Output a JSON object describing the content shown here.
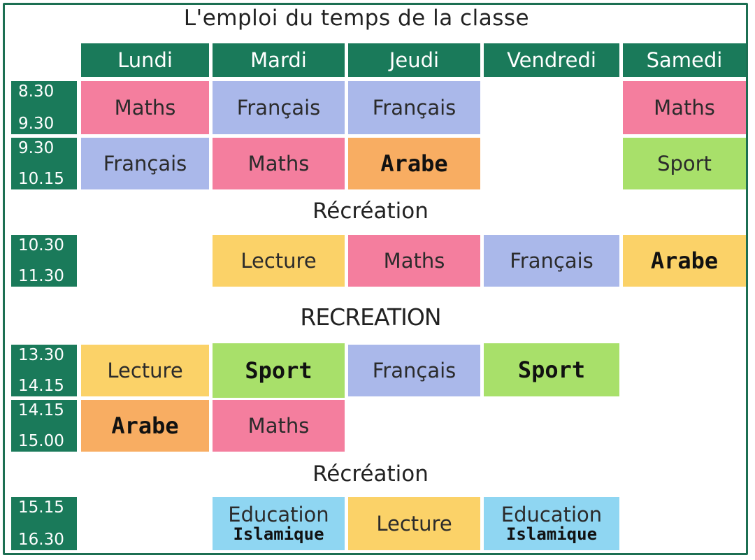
{
  "title": "L'emploi du temps de la classe",
  "days": [
    "Lundi",
    "Mardi",
    "Jeudi",
    "Vendredi",
    "Samedi"
  ],
  "times": [
    {
      "start": "8.30",
      "end": "9.30"
    },
    {
      "start": "9.30",
      "end": "10.15"
    },
    {
      "start": "10.30",
      "end": "11.30"
    },
    {
      "start": "13.30",
      "end": "14.15"
    },
    {
      "start": "14.15",
      "end": "15.00"
    },
    {
      "start": "15.15",
      "end": "16.30"
    }
  ],
  "breaks": [
    "Récréation",
    "RECREATION",
    "Récréation"
  ],
  "slots": {
    "r1": {
      "lundi": "Maths",
      "mardi": "Français",
      "jeudi": "Français",
      "samedi": "Maths"
    },
    "r2": {
      "lundi": "Français",
      "mardi": "Maths",
      "jeudi": "Arabe",
      "samedi": "Sport"
    },
    "r3": {
      "mardi": "Lecture",
      "jeudi": "Maths",
      "vendredi": "Français",
      "samedi": "Arabe"
    },
    "r4": {
      "lundi": "Lecture",
      "mardi": "Sport",
      "jeudi": "Français",
      "vendredi": "Sport"
    },
    "r5": {
      "lundi": "Arabe",
      "mardi": "Maths"
    },
    "r6": {
      "mardi": {
        "line1": "Education",
        "line2": "Islamique"
      },
      "jeudi": "Lecture",
      "vendredi": {
        "line1": "Education",
        "line2": "Islamique"
      }
    }
  },
  "colors": {
    "header": "#1a7a5a",
    "maths": "#f47e9e",
    "francais": "#aab8ea",
    "arabe": "#f8ad62",
    "lecture": "#fbd268",
    "sport": "#a8e06a",
    "education_islamique": "#8fd6f2"
  }
}
